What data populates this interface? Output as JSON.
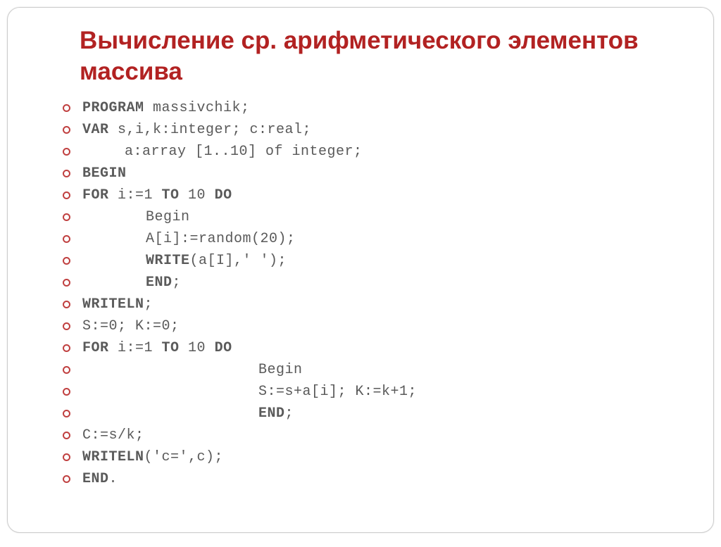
{
  "heading": "Вычисление  ср. арифметического элементов массива",
  "lines": {
    "l0_a": "Program",
    "l0_b": " massivchik;",
    "l1_a": "var",
    "l1_b": " s,i,k:integer; c:real;",
    "l2": "a:array [1..10] of integer;",
    "l3": "BEGIN",
    "l4_a": "for",
    "l4_b": " i:=1 ",
    "l4_c": "to",
    "l4_d": " 10 ",
    "l4_e": "do",
    "l5": "Begin",
    "l6": "A[i]:=random(20);",
    "l7_a": "Write",
    "l7_b": "(a[I],' ');",
    "l8_a": "end",
    "l8_b": ";",
    "l9_a": "Writeln",
    "l9_b": ";",
    "l10": "S:=0; K:=0;",
    "l11_a": "for",
    "l11_b": " i:=1 ",
    "l11_c": "to",
    "l11_d": " 10 ",
    "l11_e": "do",
    "l12": "Begin",
    "l13": "S:=s+a[i]; K:=k+1;",
    "l14_a": "end",
    "l14_b": ";",
    "l15": "C:=s/k;",
    "l16_a": "Writeln",
    "l16_b": "('c=',c);",
    "l17_a": "END",
    "l17_b": "."
  }
}
